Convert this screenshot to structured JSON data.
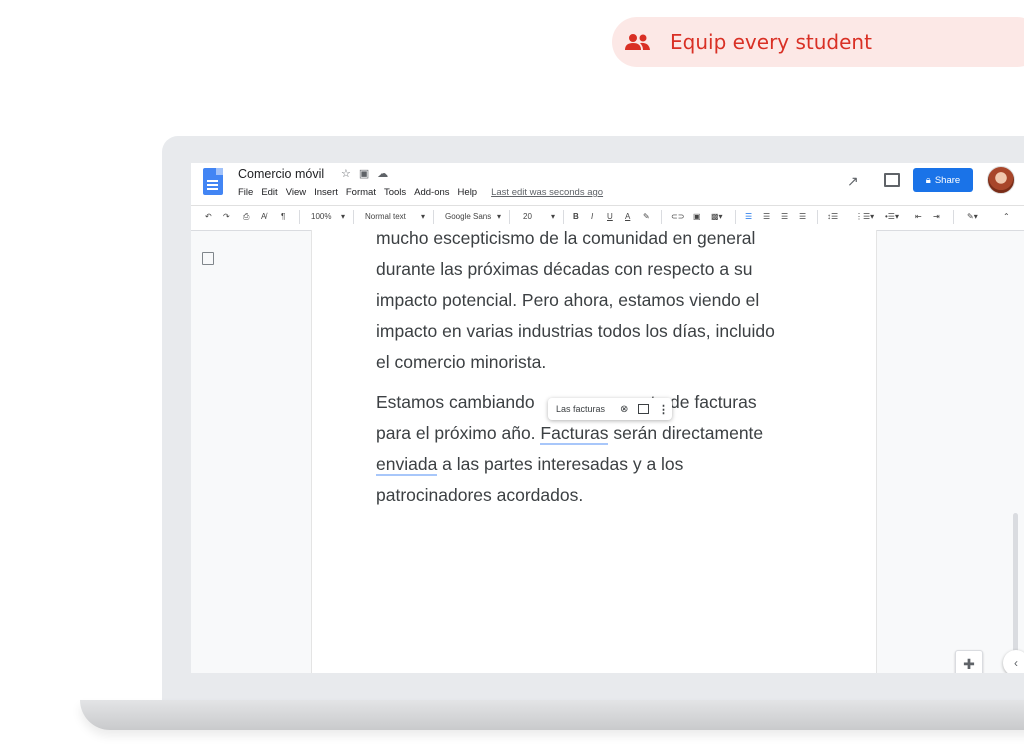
{
  "banner": {
    "text": "Equip every student",
    "icon": "people-icon",
    "color": "#d93025"
  },
  "doc": {
    "title": "Comercio móvil",
    "menu": [
      "File",
      "Edit",
      "View",
      "Insert",
      "Format",
      "Tools",
      "Add-ons",
      "Help"
    ],
    "last_edit": "Last edit was seconds ago",
    "share_label": "Share"
  },
  "toolbar": {
    "zoom": "100%",
    "style": "Normal text",
    "font": "Google Sans",
    "size": "20"
  },
  "body": {
    "p1": [
      "mucho escepticismo de la comunidad en general",
      "durante las próximas décadas con respecto a su",
      "impacto potencial. Pero ahora, estamos viendo el",
      "impacto en varias industrias todos los días, incluido",
      "el comercio minorista."
    ],
    "p2_l1a": "Estamos cambiando",
    "p2_l1b": "to de facturas",
    "p2_l2a": "para el próximo año. ",
    "p2_l2b": "Facturas",
    "p2_l2c": " serán directamente",
    "p2_l3a": "enviada",
    "p2_l3b": " a las partes interesadas y a los",
    "p2_l4": "patrocinadores acordados."
  },
  "suggestion": {
    "text": "Las facturas"
  }
}
